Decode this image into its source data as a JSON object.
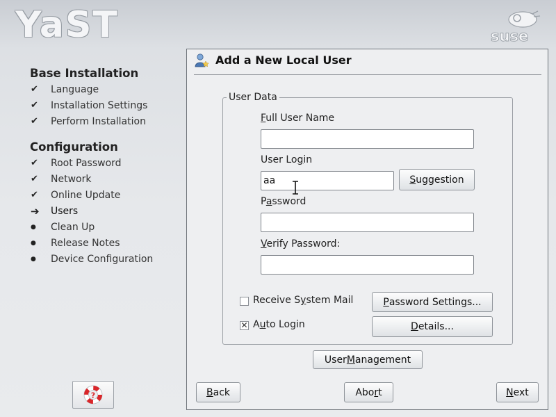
{
  "header": {
    "logo_text": "YaST",
    "brand_text": "suse"
  },
  "sidebar": {
    "sections": [
      {
        "title": "Base Installation",
        "items": [
          {
            "label": "Language",
            "state": "done"
          },
          {
            "label": "Installation Settings",
            "state": "done"
          },
          {
            "label": "Perform Installation",
            "state": "done"
          }
        ]
      },
      {
        "title": "Configuration",
        "items": [
          {
            "label": "Root Password",
            "state": "done"
          },
          {
            "label": "Network",
            "state": "done"
          },
          {
            "label": "Online Update",
            "state": "done"
          },
          {
            "label": "Users",
            "state": "current"
          },
          {
            "label": "Clean Up",
            "state": "pending"
          },
          {
            "label": "Release Notes",
            "state": "pending"
          },
          {
            "label": "Device Configuration",
            "state": "pending"
          }
        ]
      }
    ],
    "marks": {
      "done": "✔",
      "current": "➔",
      "pending": "●"
    }
  },
  "dialog": {
    "title": "Add a New Local User",
    "group_label": "User Data",
    "full_name": {
      "label": "Full User Name",
      "value": ""
    },
    "login": {
      "label": "User Login",
      "value": "aa"
    },
    "suggestion_button": "Suggestion",
    "password": {
      "label": "Password",
      "value": ""
    },
    "verify_password": {
      "label": "Verify Password:",
      "value": ""
    },
    "receive_mail": {
      "label": "Receive System Mail",
      "checked": false
    },
    "auto_login": {
      "label": "Auto Login",
      "checked": true
    },
    "password_settings_button": "Password Settings...",
    "details_button": "Details...",
    "user_management_button": "User Management"
  },
  "footer": {
    "back": "Back",
    "abort": "Abort",
    "next": "Next"
  },
  "colors": {
    "background": "#e6e8eb",
    "panel": "#eeeff1",
    "help_icon": "#d9262a"
  }
}
